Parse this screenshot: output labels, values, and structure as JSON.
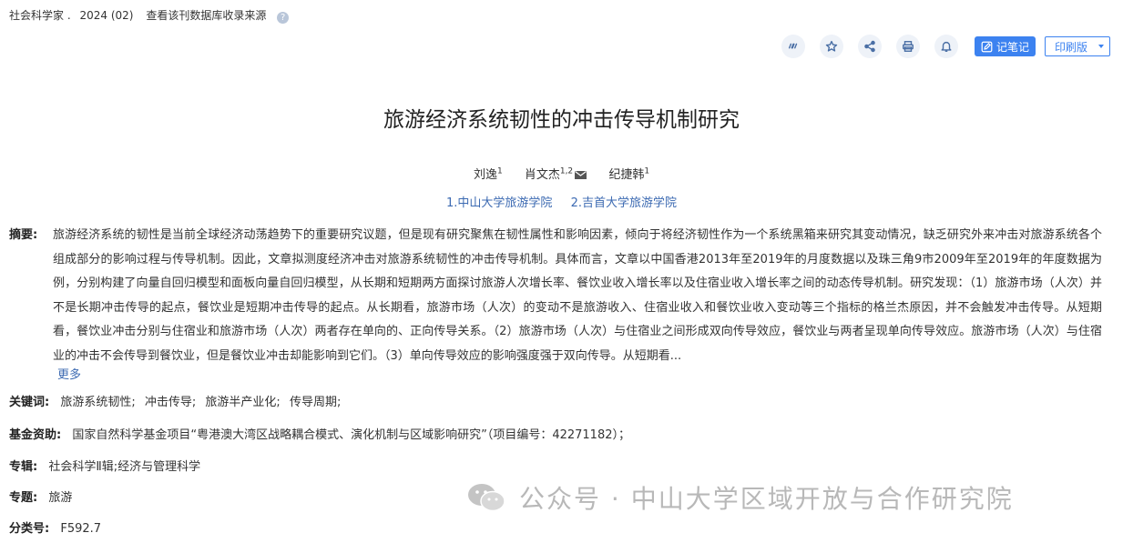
{
  "source": {
    "journal": "社会科学家",
    "sep": ".",
    "issue": "2024 (02)",
    "db_link": "查看该刊数据库收录来源",
    "help_glyph": "?"
  },
  "toolbar": {
    "icons": [
      "quote-icon",
      "star-icon",
      "share-icon",
      "print-icon",
      "bell-icon"
    ],
    "note_label": "记笔记",
    "print_label": "印刷版"
  },
  "article": {
    "title": "旅游经济系统韧性的冲击传导机制研究",
    "authors": [
      {
        "name": "刘逸",
        "sup": "1"
      },
      {
        "name": "肖文杰",
        "sup": "1,2"
      },
      {
        "name": "纪捷韩",
        "sup": "1"
      }
    ],
    "affiliations": [
      "1.中山大学旅游学院",
      "2.吉首大学旅游学院"
    ]
  },
  "abstract": {
    "label": "摘要:",
    "text": "旅游经济系统的韧性是当前全球经济动荡趋势下的重要研究议题，但是现有研究聚焦在韧性属性和影响因素，倾向于将经济韧性作为一个系统黑箱来研究其变动情况，缺乏研究外来冲击对旅游系统各个组成部分的影响过程与传导机制。因此，文章拟测度经济冲击对旅游系统韧性的冲击传导机制。具体而言，文章以中国香港2013年至2019年的月度数据以及珠三角9市2009年至2019年的年度数据为例，分别构建了向量自回归模型和面板向量自回归模型，从长期和短期两方面探讨旅游人次增长率、餐饮业收入增长率以及住宿业收入增长率之间的动态传导机制。研究发现：（1）旅游市场（人次）并不是长期冲击传导的起点，餐饮业是短期冲击传导的起点。从长期看，旅游市场（人次）的变动不是旅游收入、住宿业收入和餐饮业收入变动等三个指标的格兰杰原因，并不会触发冲击传导。从短期看，餐饮业冲击分别与住宿业和旅游市场（人次）两者存在单向的、正向传导关系。（2）旅游市场（人次）与住宿业之间形成双向传导效应，餐饮业与两者呈现单向传导效应。旅游市场（人次）与住宿业的冲击不会传导到餐饮业，但是餐饮业冲击却能影响到它们。（3）单向传导效应的影响强度强于双向传导。从短期看...",
    "more_label": "更多"
  },
  "keywords": {
    "label": "关键词:",
    "items": [
      "旅游系统韧性;",
      "冲击传导;",
      "旅游半产业化;",
      "传导周期;"
    ]
  },
  "fund": {
    "label": "基金资助:",
    "text": "国家自然科学基金项目“粤港澳大湾区战略耦合模式、演化机制与区域影响研究”（项目编号：42271182）；"
  },
  "album": {
    "label": "专辑:",
    "value": "社会科学Ⅱ辑;经济与管理科学"
  },
  "topic": {
    "label": "专题:",
    "value": "旅游"
  },
  "classno": {
    "label": "分类号:",
    "value": "F592.7"
  },
  "watermark": {
    "text": "公众号 · 中山大学区域开放与合作研究院"
  }
}
